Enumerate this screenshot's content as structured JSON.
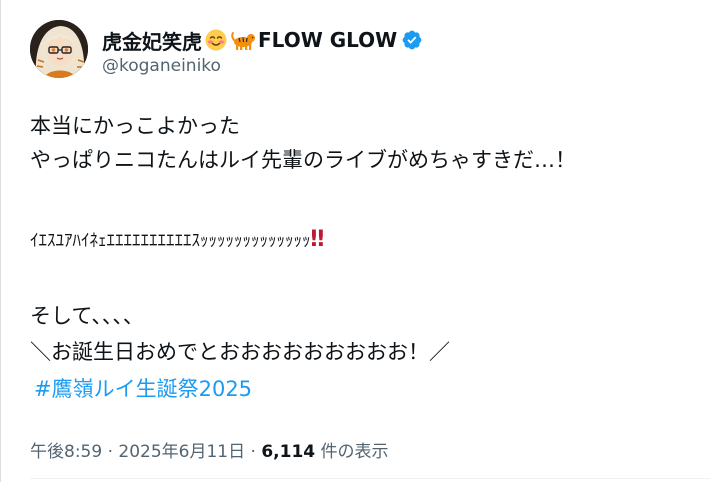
{
  "author": {
    "display_name": "虎金妃笑虎",
    "name_suffix": "FLOW GLOW",
    "handle": "@koganeiniko"
  },
  "tweet": {
    "line1": "本当にかっこよかった",
    "line2": "やっぱりニコたんはルイ先輩のライブがめちゃすきだ…！",
    "line3_text": "ｲｴｽﾕｱﾊｲﾈｪｴｴｴｴｴｴｴｴｴｴｽｯｯｯｯｯｯｯｯｯｯｯｯｯ",
    "line3_bangs": "‼",
    "line4": "そして、、、、",
    "line5": "＼お誕生日おめでとおおおおおおおおお！／",
    "hashtag": "#鷹嶺ルイ生誕祭2025"
  },
  "meta": {
    "time": "午後8:59",
    "separator1": " · ",
    "date": "2025年6月11日",
    "separator2": " · ",
    "views_count": "6,114",
    "views_label": " 件の表示"
  },
  "colors": {
    "text": "#0f1419",
    "secondary": "#536471",
    "link": "#1d9bf0",
    "verified": "#1d9bf0",
    "bangs": "#be1931"
  },
  "icons": {
    "emoji1": "smiling-face-with-blush-icon",
    "emoji2": "tiger-icon",
    "verified": "verified-badge-icon"
  }
}
